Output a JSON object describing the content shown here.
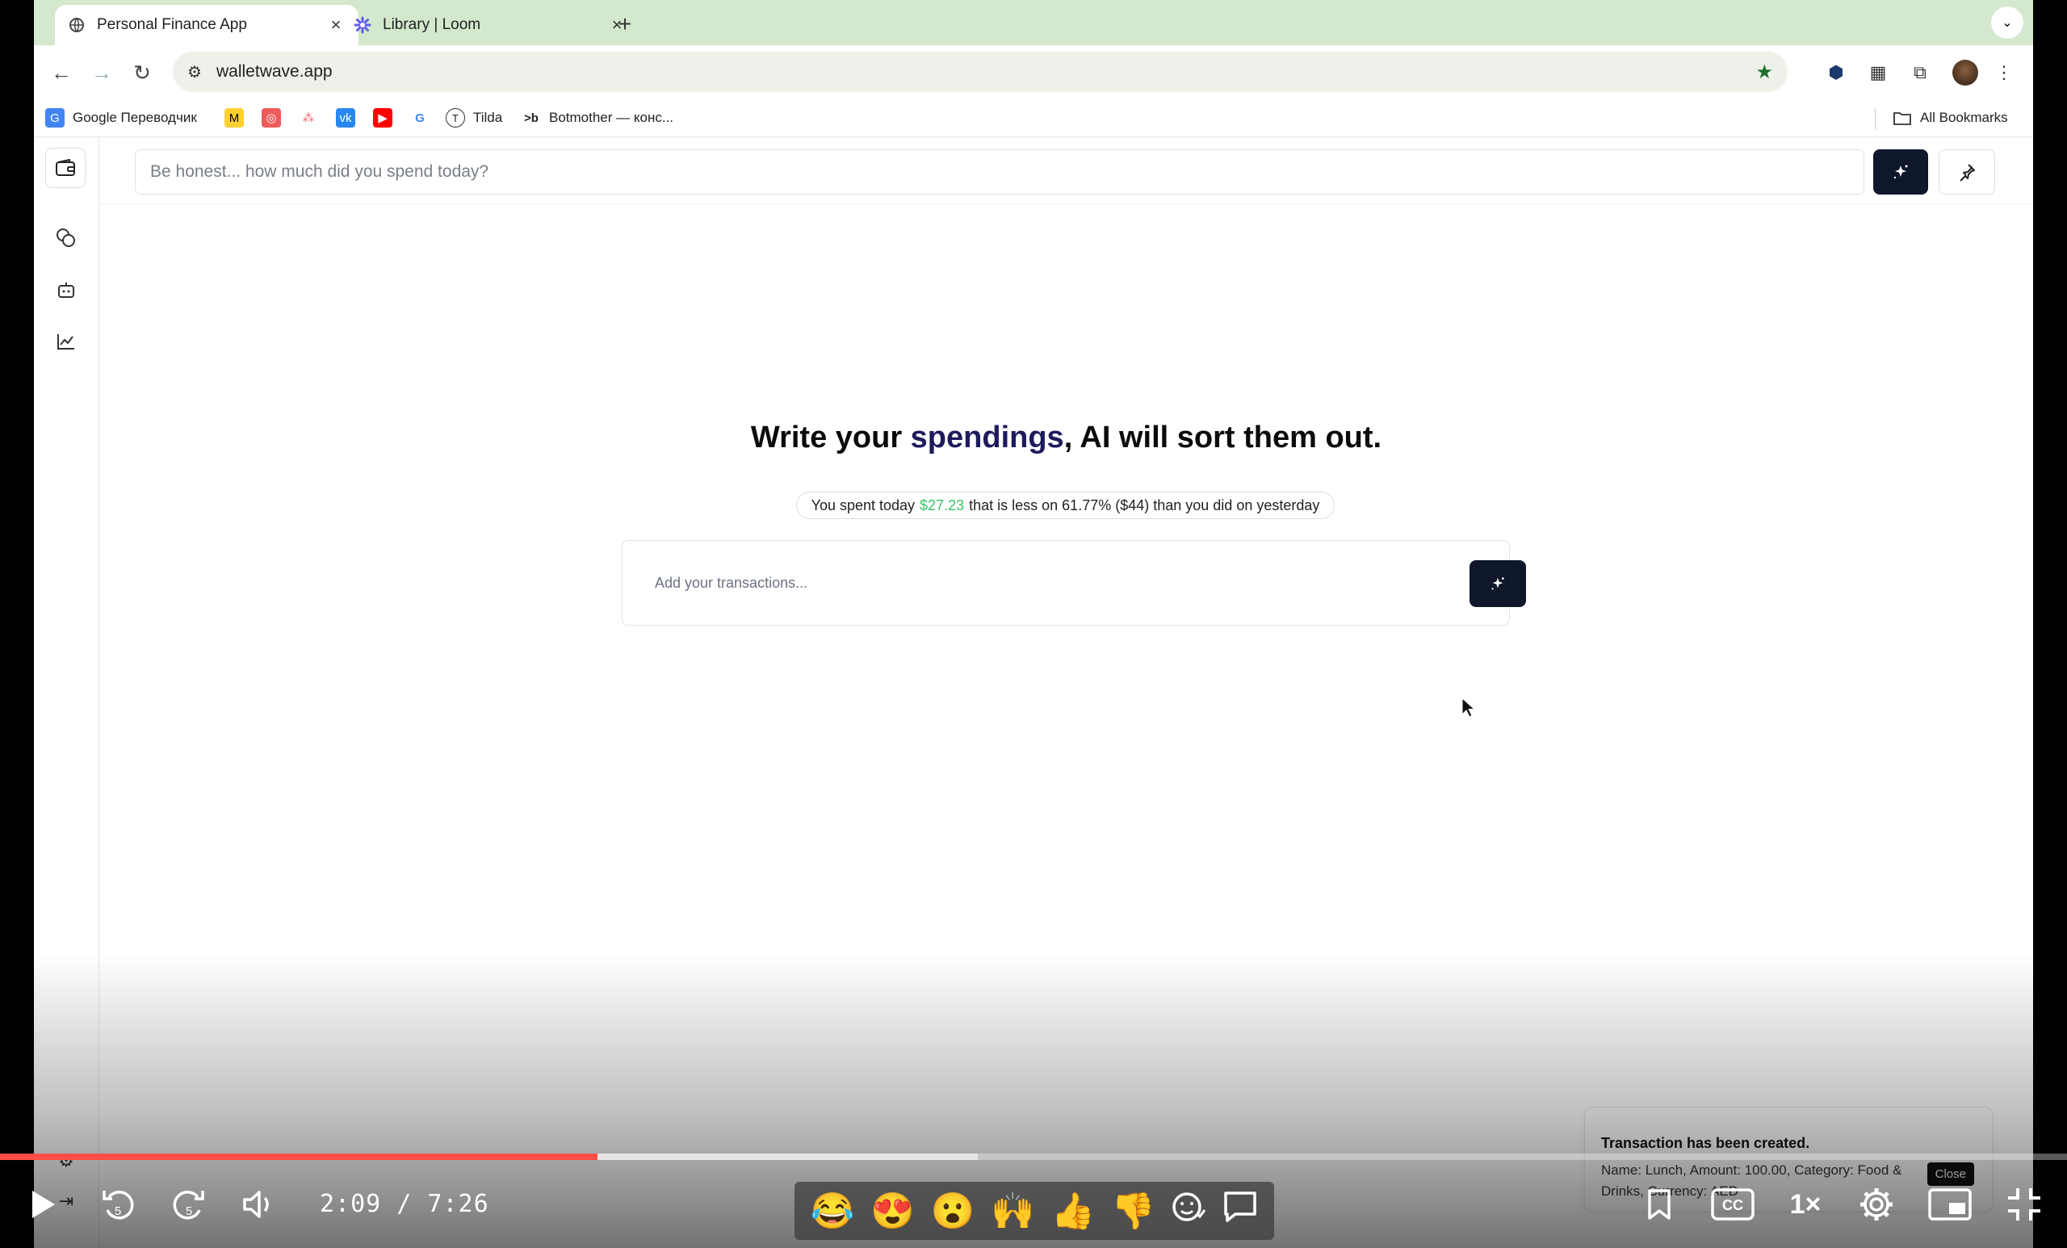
{
  "browser": {
    "tabs": [
      {
        "title": "Personal Finance App",
        "active": true
      },
      {
        "title": "Library | Loom",
        "active": false
      }
    ],
    "close_glyph": "×",
    "new_tab_glyph": "+",
    "url": "walletwave.app",
    "bookmarks": [
      {
        "label": "Google Переводчик"
      },
      {
        "label": "Tilda"
      },
      {
        "label": "Botmother — конс..."
      }
    ],
    "all_bookmarks": "All Bookmarks"
  },
  "app": {
    "quick_input_placeholder": "Be honest... how much did you spend today?",
    "hero": {
      "prefix": "Write your ",
      "accent": "spendings",
      "suffix": ", AI will sort them out."
    },
    "summary": {
      "prefix": "You spent today",
      "amount": "$27.23",
      "suffix": "that is less on 61.77% ($44) than you did on yesterday"
    },
    "transactions_placeholder": "Add your transactions...",
    "toast": {
      "title": "Transaction has been created.",
      "body": "Name: Lunch, Amount: 100.00, Category: Food & Drinks, Currency: AED",
      "close_label": "Close"
    },
    "colors": {
      "primary_button": "#0f172a",
      "accent_text": "#1e1b5c",
      "amount_green": "#3cc46b"
    }
  },
  "video": {
    "current_time": "2:09",
    "total_time": "7:26",
    "time_display": "2:09 / 7:26",
    "played_fraction": 0.289,
    "buffered_fraction": 0.473,
    "speed": "1×",
    "skip_back_seconds": "5",
    "skip_forward_seconds": "5",
    "reactions": [
      "😂",
      "😍",
      "😮",
      "🙌",
      "👍",
      "👎"
    ],
    "progress_color": "#ff4e45"
  }
}
